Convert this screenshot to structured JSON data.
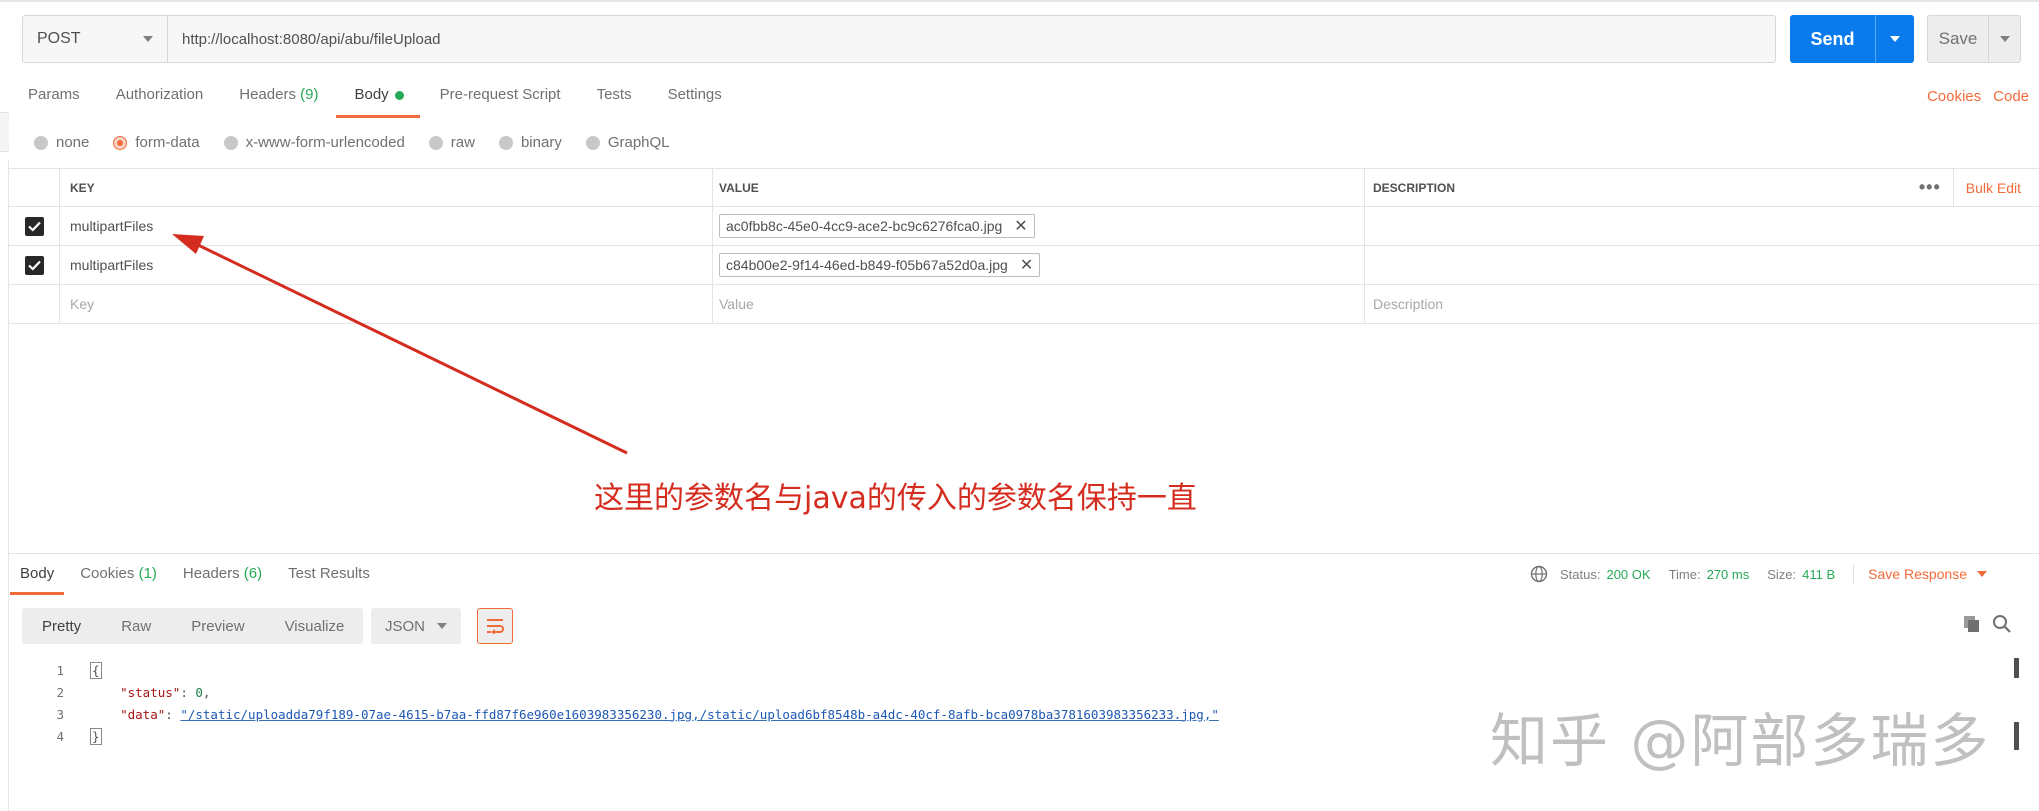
{
  "request": {
    "method": "POST",
    "url": "http://localhost:8080/api/abu/fileUpload",
    "send_label": "Send",
    "save_label": "Save"
  },
  "request_tabs": [
    {
      "label": "Params"
    },
    {
      "label": "Authorization"
    },
    {
      "label": "Headers",
      "count": "(9)"
    },
    {
      "label": "Body",
      "active": true
    },
    {
      "label": "Pre-request Script"
    },
    {
      "label": "Tests"
    },
    {
      "label": "Settings"
    }
  ],
  "right_links": {
    "cookies": "Cookies",
    "code": "Code"
  },
  "body_types": [
    {
      "label": "none"
    },
    {
      "label": "form-data",
      "selected": true
    },
    {
      "label": "x-www-form-urlencoded"
    },
    {
      "label": "raw"
    },
    {
      "label": "binary"
    },
    {
      "label": "GraphQL"
    }
  ],
  "params_table": {
    "headers": {
      "key": "KEY",
      "value": "VALUE",
      "description": "DESCRIPTION",
      "bulk_edit": "Bulk Edit",
      "more": "•••"
    },
    "rows": [
      {
        "key": "multipartFiles",
        "value": "ac0fbb8c-45e0-4cc9-ace2-bc9c6276fca0.jpg",
        "checked": true
      },
      {
        "key": "multipartFiles",
        "value": "c84b00e2-9f14-46ed-b849-f05b67a52d0a.jpg",
        "checked": true
      }
    ],
    "placeholders": {
      "key": "Key",
      "value": "Value",
      "description": "Description"
    }
  },
  "annotation": "这里的参数名与java的传入的参数名保持一直",
  "response": {
    "tabs": [
      {
        "label": "Body",
        "active": true
      },
      {
        "label": "Cookies",
        "count": "(1)"
      },
      {
        "label": "Headers",
        "count": "(6)"
      },
      {
        "label": "Test Results"
      }
    ],
    "status_label": "Status:",
    "status_value": "200 OK",
    "time_label": "Time:",
    "time_value": "270 ms",
    "size_label": "Size:",
    "size_value": "411 B",
    "save_response": "Save Response",
    "view_modes": [
      "Pretty",
      "Raw",
      "Preview",
      "Visualize"
    ],
    "format": "JSON",
    "code_lines": [
      {
        "n": "1",
        "text": "{"
      },
      {
        "n": "2",
        "key": "\"status\"",
        "value": "0"
      },
      {
        "n": "3",
        "key": "\"data\"",
        "value": "\"/static/uploadda79f189-07ae-4615-b7aa-ffd87f6e960e1603983356230.jpg,/static/upload6bf8548b-a4dc-40cf-8afb-bca0978ba3781603983356233.jpg,\""
      },
      {
        "n": "4",
        "text": "}"
      }
    ]
  },
  "watermark": "知乎 @阿部多瑞多",
  "colors": {
    "accent": "#f26b3a",
    "send_blue": "#097bed",
    "success_green": "#26a955",
    "annotation_red": "#d42d1f"
  }
}
